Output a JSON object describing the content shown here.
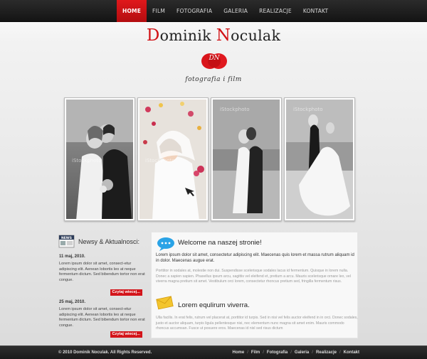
{
  "nav": {
    "items": [
      {
        "label": "HOME",
        "active": true
      },
      {
        "label": "FILM"
      },
      {
        "label": "FOTOGRAFIA"
      },
      {
        "label": "GALERIA"
      },
      {
        "label": "REALIZACJE"
      },
      {
        "label": "KONTAKT"
      }
    ]
  },
  "header": {
    "title_cap1": "D",
    "title_rest1": "ominik ",
    "title_cap2": "N",
    "title_rest2": "oculak",
    "logo_text": "DN",
    "tagline": "fotografia i film"
  },
  "gallery": {
    "photos": [
      {
        "alt": "bride-and-groom-bw",
        "watermark": "iStockphoto"
      },
      {
        "alt": "bride-with-petals",
        "watermark": "iStockphoto"
      },
      {
        "alt": "couple-on-beach",
        "watermark": "iStockphoto"
      },
      {
        "alt": "couple-by-sea",
        "watermark": "iStockphoto"
      }
    ]
  },
  "news": {
    "icon_label": "NEWS",
    "title": "Newsy & Aktualnosci:",
    "entries": [
      {
        "date": "11 maj, 2010.",
        "text": "Lorem ipsum dolor sit amet, consect-etur adipiscing elit. Aenean lobortis leo at neque fermentum dictum. Sed bibendum tortor non erat congue.",
        "more": "Czytaj wiecej..."
      },
      {
        "date": "25 maj, 2010.",
        "text": "Lorem ipsum dolor sit amet, consect-etur adipiscing elit. Aenean lobortis leo at neque fermentum dictum. Sed bibendum tortor non erat congue.",
        "more": "Czytaj wiecej..."
      }
    ]
  },
  "content": {
    "welcome_title": "Welcome na naszej stronie!",
    "lead": "Lorem ipsum dolor sit amet, consectetur adipiscing elit. Maecenas quis lorem et massa rutrum aliquam id in dolor. Maecenas augue erat.",
    "body": "Porttitor in sodales at, molestie non dui. Suspendisse scelerisque sodales lacus id fermentum. Quisque in lorem nulla. Donec a sapien sapien. Phasellus ipsum arcu, sagittis vel eleifend et, pretium a arcu. Mauris scelerisque ornare leo, vel viverra magna pretium sit amet. Vestibulum orci lorem, consectetur rhoncus pretium sed, fringilla fermentum risus.",
    "lorem_title": "Lorem equlirum viverra.",
    "body2": "Ulla facilis. In erat felis, rutrum vel placerat at, porttitor id turpis. Sed in nisi vel felis auctor eleifend in in orci. Donec sodales, justo et auctor aliquam, turpis ligula pellentesque nisi, nec elementum nunc magna sit amet enim. Mauris commodo rhoncus accumsan. Fusce ut posuere eros. Maecenas id nisl sed risus dictum"
  },
  "footer": {
    "copyright": "© 2010 Dominik Noculak. All Rights Reserved.",
    "links": [
      "Home",
      "Film",
      "Fotografia",
      "Galeria",
      "Realizacje",
      "Kontakt"
    ],
    "separator": "/"
  },
  "colors": {
    "accent": "#d11216",
    "nav_bg": "#1e1e1e",
    "footer_bg": "#222222"
  }
}
